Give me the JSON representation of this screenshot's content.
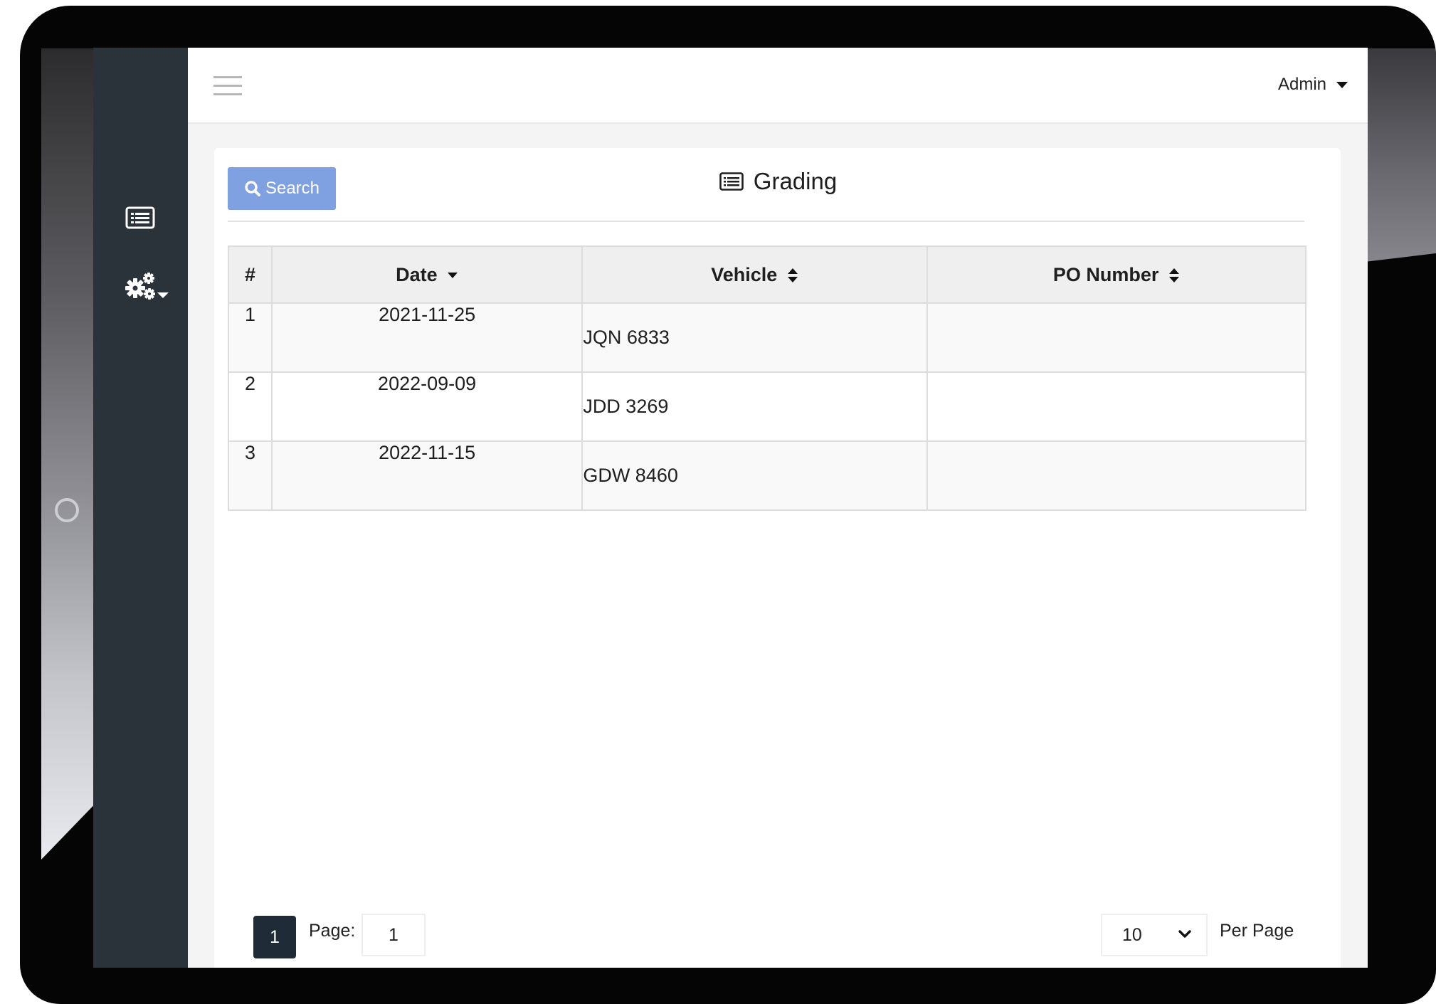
{
  "header": {
    "user_menu_label": "Admin"
  },
  "sidebar": {
    "items": [
      {
        "icon": "list-icon"
      },
      {
        "icon": "gears-icon"
      }
    ]
  },
  "card": {
    "search_label": "Search",
    "title": "Grading"
  },
  "table": {
    "columns": [
      "#",
      "Date",
      "Vehicle",
      "PO Number"
    ],
    "rows": [
      {
        "num": "1",
        "date": "2021-11-25",
        "vehicle": "JQN 6833",
        "po": ""
      },
      {
        "num": "2",
        "date": "2022-09-09",
        "vehicle": "JDD 3269",
        "po": ""
      },
      {
        "num": "3",
        "date": "2022-11-15",
        "vehicle": "GDW 8460",
        "po": ""
      }
    ]
  },
  "pagination": {
    "current_page_button": "1",
    "page_label": "Page:",
    "page_input_value": "1",
    "per_page_value": "10",
    "per_page_label": "Per Page"
  },
  "colors": {
    "sidebar": "#2a323a",
    "search_button": "#7fa1e2",
    "active_page": "#1f2b36"
  }
}
